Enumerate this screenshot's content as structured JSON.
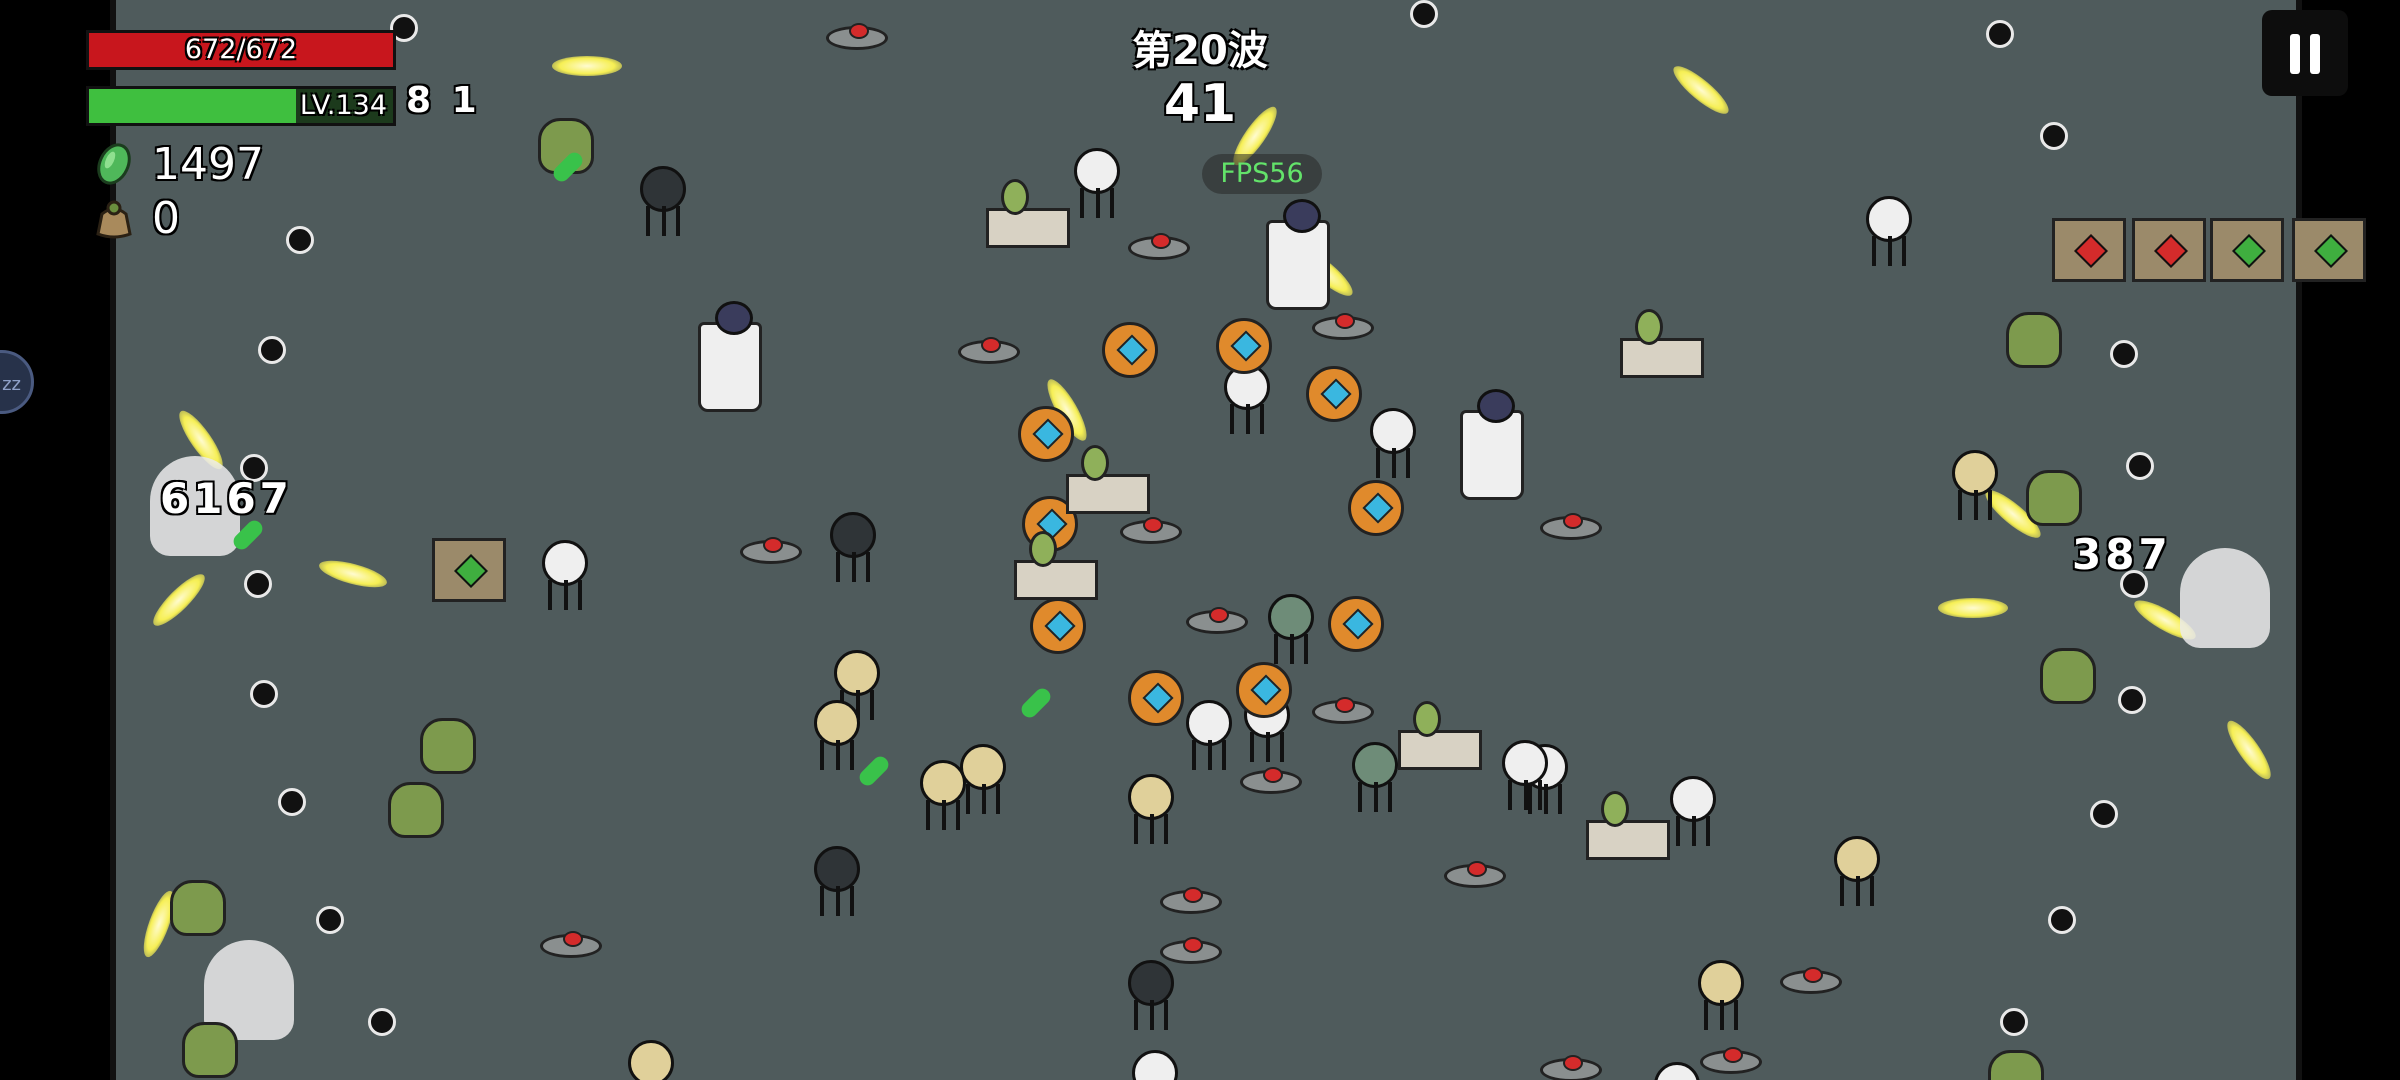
{
  "hud": {
    "hp": {
      "text": "672/672",
      "current": 672,
      "max": 672,
      "fill_color": "#c8161d"
    },
    "xp": {
      "level_text": "LV.134",
      "fill_fraction": 0.68,
      "fill_color": "#3fbf3f"
    },
    "resources": [
      {
        "icon": "green-gem-icon",
        "value": "1497"
      },
      {
        "icon": "loot-bag-icon",
        "value": "0"
      }
    ],
    "wave": {
      "label": "第20波",
      "timer": "41"
    },
    "fps": "FPS56",
    "pause_icon": "pause-icon",
    "side_tab": "zz"
  },
  "floating_numbers": [
    "6167",
    "387",
    "8 1"
  ],
  "colors": {
    "arena": "#4f5b5c",
    "projectile": "#f6ef54",
    "fps_text": "#63e36a",
    "mine_light": "#d42b2b"
  },
  "sprite_types": [
    "mine",
    "orb",
    "projectile",
    "walker-robot",
    "crate",
    "ghost",
    "plant-monster",
    "drone",
    "planter",
    "totem",
    "green-stick-pickup"
  ]
}
